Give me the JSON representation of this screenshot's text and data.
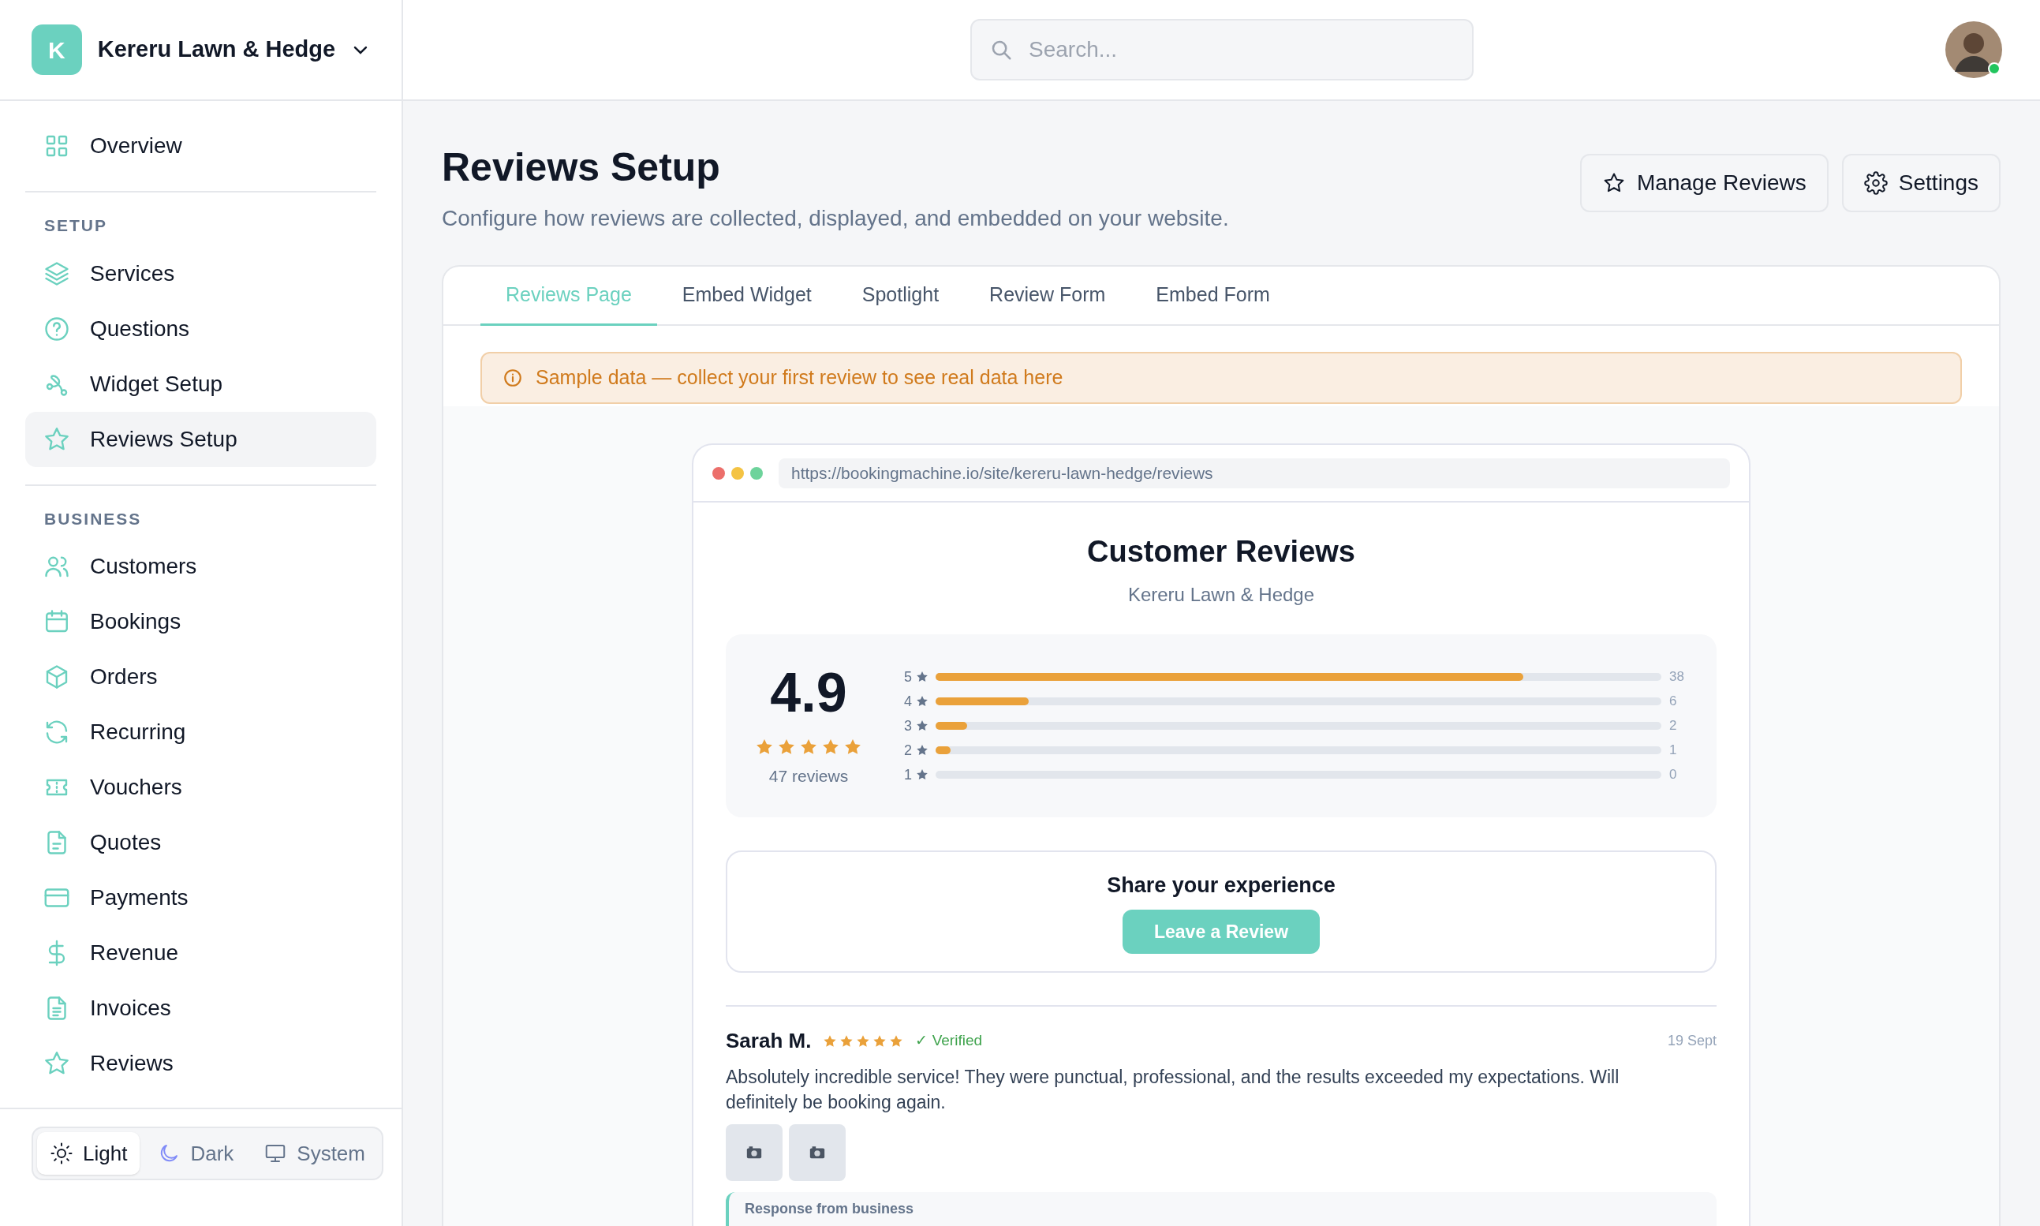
{
  "brand": {
    "initial": "K",
    "name": "Kereru Lawn & Hedge"
  },
  "sidebar": {
    "top_items": [
      {
        "label": "Overview",
        "selected": false
      }
    ],
    "sections": [
      {
        "title": "SETUP",
        "items": [
          {
            "label": "Services",
            "selected": false
          },
          {
            "label": "Questions",
            "selected": false
          },
          {
            "label": "Widget Setup",
            "selected": false
          },
          {
            "label": "Reviews Setup",
            "selected": true
          }
        ]
      },
      {
        "title": "BUSINESS",
        "items": [
          {
            "label": "Customers",
            "selected": false
          },
          {
            "label": "Bookings",
            "selected": false
          },
          {
            "label": "Orders",
            "selected": false
          },
          {
            "label": "Recurring",
            "selected": false
          },
          {
            "label": "Vouchers",
            "selected": false
          },
          {
            "label": "Quotes",
            "selected": false
          },
          {
            "label": "Payments",
            "selected": false
          },
          {
            "label": "Revenue",
            "selected": false
          },
          {
            "label": "Invoices",
            "selected": false
          },
          {
            "label": "Reviews",
            "selected": false
          }
        ]
      }
    ]
  },
  "theme_switcher": [
    {
      "label": "Light",
      "selected": true
    },
    {
      "label": "Dark",
      "selected": false
    },
    {
      "label": "System",
      "selected": false
    }
  ],
  "search": {
    "placeholder": "Search..."
  },
  "page": {
    "title": "Reviews Setup",
    "subtitle": "Configure how reviews are collected, displayed, and embedded on your website.",
    "actions": [
      {
        "label": "Manage Reviews",
        "kind": "star"
      },
      {
        "label": "Settings",
        "kind": "gear"
      }
    ]
  },
  "tabs": [
    {
      "label": "Reviews Page",
      "selected": true
    },
    {
      "label": "Embed Widget",
      "selected": false
    },
    {
      "label": "Spotlight",
      "selected": false
    },
    {
      "label": "Review Form",
      "selected": false
    },
    {
      "label": "Embed Form",
      "selected": false
    }
  ],
  "notice": "Sample data — collect your first review to see real data here",
  "preview": {
    "url": "https://bookingmachine.io/site/kereru-lawn-hedge/reviews",
    "heading": "Customer Reviews",
    "business": "Kereru Lawn & Hedge",
    "rating": {
      "score": "4.9",
      "stars": 5,
      "count_label": "47 reviews"
    },
    "breakdown": [
      {
        "label": "5",
        "level": 0.81,
        "count": "38"
      },
      {
        "label": "4",
        "level": 0.128,
        "count": "6"
      },
      {
        "label": "3",
        "level": 0.043,
        "count": "2"
      },
      {
        "label": "2",
        "level": 0.021,
        "count": "1"
      },
      {
        "label": "1",
        "level": 0,
        "count": "0"
      }
    ],
    "cta": {
      "title": "Share your experience",
      "button": "Leave a Review"
    },
    "reviews": [
      {
        "name": "Sarah M.",
        "stars": 5,
        "verified": true,
        "verified_label": "✓ Verified",
        "date": "19 Sept",
        "text": "Absolutely incredible service! They were punctual, professional, and the results exceeded my expectations. Will definitely be booking again.",
        "photos": [
          {
            "kind": "placeholder"
          },
          {
            "kind": "placeholder"
          }
        ],
        "response_label": "Response from business"
      }
    ]
  }
}
